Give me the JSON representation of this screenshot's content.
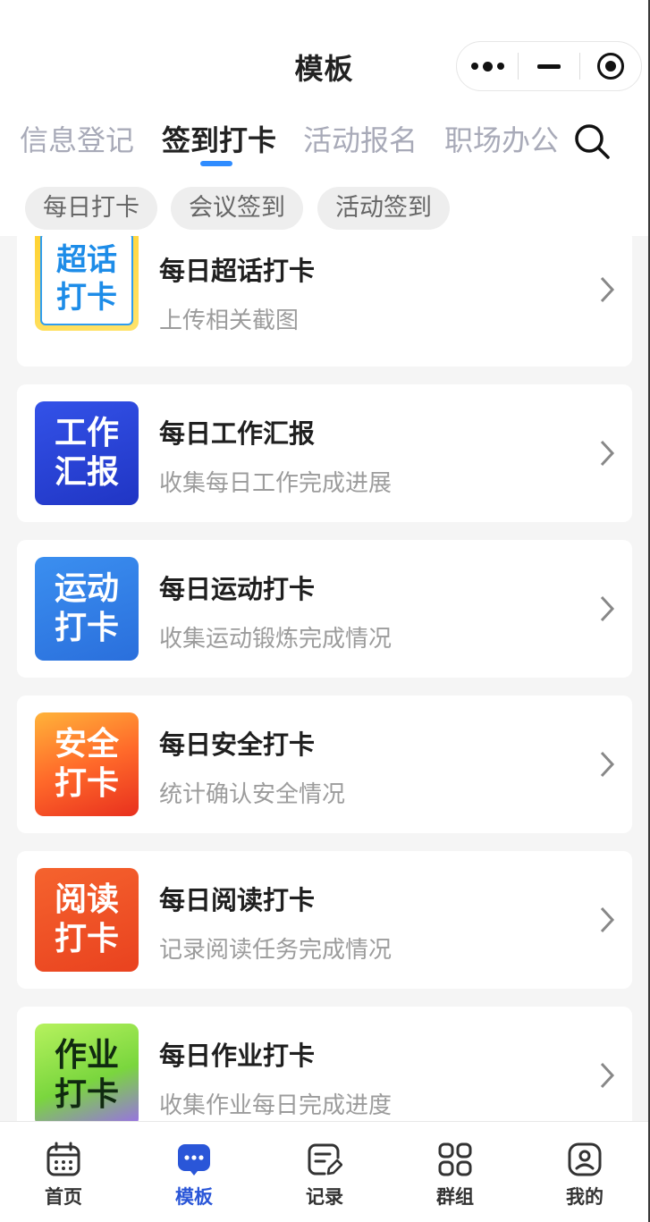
{
  "header": {
    "title": "模板"
  },
  "tabs": [
    {
      "label": "信息登记",
      "active": false
    },
    {
      "label": "签到打卡",
      "active": true
    },
    {
      "label": "活动报名",
      "active": false
    },
    {
      "label": "职场办公",
      "active": false
    }
  ],
  "chips": [
    "每日打卡",
    "会议签到",
    "活动签到"
  ],
  "cards": [
    {
      "title": "每日超话打卡",
      "subtitle": "上传相关截图",
      "icon_text": [
        "超话",
        "打卡"
      ],
      "icon_color": "#2e9df0"
    },
    {
      "title": "每日工作汇报",
      "subtitle": "收集每日工作完成进展",
      "icon_text": [
        "工作",
        "汇报"
      ],
      "icon_color": "#2b3fd6"
    },
    {
      "title": "每日运动打卡",
      "subtitle": "收集运动锻炼完成情况",
      "icon_text": [
        "运动",
        "打卡"
      ],
      "icon_color": "#2f7de8"
    },
    {
      "title": "每日安全打卡",
      "subtitle": "统计确认安全情况",
      "icon_text": [
        "安全",
        "打卡"
      ],
      "icon_color": "#f0452a"
    },
    {
      "title": "每日阅读打卡",
      "subtitle": "记录阅读任务完成情况",
      "icon_text": [
        "阅读",
        "打卡"
      ],
      "icon_color": "#ec4f26"
    },
    {
      "title": "每日作业打卡",
      "subtitle": "收集作业每日完成进度",
      "icon_text": [
        "作业",
        "打卡"
      ],
      "icon_color": "#8fe04a"
    }
  ],
  "bottom_nav": [
    {
      "label": "首页",
      "icon": "calendar-icon",
      "active": false
    },
    {
      "label": "模板",
      "icon": "chat-dots-icon",
      "active": true
    },
    {
      "label": "记录",
      "icon": "edit-note-icon",
      "active": false
    },
    {
      "label": "群组",
      "icon": "grid-icon",
      "active": false
    },
    {
      "label": "我的",
      "icon": "profile-icon",
      "active": false
    }
  ],
  "colors": {
    "accent": "#2f8cff",
    "nav_active": "#2a56d8",
    "list_bg": "#f5f5f5"
  }
}
